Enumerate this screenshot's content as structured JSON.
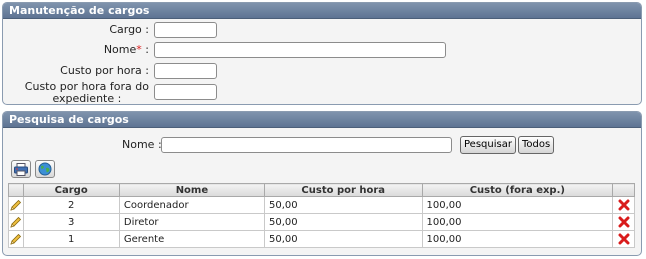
{
  "maintenance": {
    "title": "Manutenção de cargos",
    "cargo_label": "Cargo :",
    "nome_label": "Nome",
    "nome_required": "*",
    "nome_colon": ":",
    "custo_hora_label": "Custo por hora :",
    "custo_fora_label_line1": "Custo por hora fora do",
    "custo_fora_label_line2": "expediente :",
    "cargo_value": "",
    "nome_value": "",
    "custo_hora_value": "",
    "custo_fora_value": ""
  },
  "search": {
    "title": "Pesquisa de cargos",
    "nome_label": "Nome :",
    "nome_value": "",
    "pesquisar_label": "Pesquisar",
    "todos_label": "Todos"
  },
  "toolbar": {
    "icons": [
      "print-icon",
      "globe-icon"
    ]
  },
  "table": {
    "headers": [
      "Cargo",
      "Nome",
      "Custo por hora",
      "Custo (fora exp.)"
    ],
    "rows": [
      {
        "cargo": "2",
        "nome": "Coordenador",
        "custo": "50,00",
        "custo_fora": "100,00"
      },
      {
        "cargo": "3",
        "nome": "Diretor",
        "custo": "50,00",
        "custo_fora": "100,00"
      },
      {
        "cargo": "1",
        "nome": "Gerente",
        "custo": "50,00",
        "custo_fora": "100,00"
      }
    ],
    "edit_icon": "pencil-icon",
    "delete_icon": "red-x-icon"
  },
  "colors": {
    "header_bg": "#6b7f9c",
    "panel_bg": "#f4f4f4",
    "delete": "#d91b1b",
    "required": "#dd2222"
  }
}
